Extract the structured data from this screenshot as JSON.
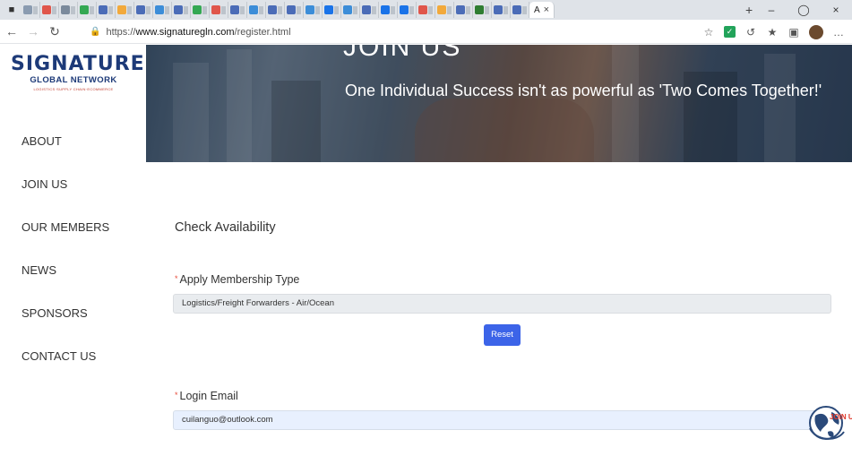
{
  "browser": {
    "active_tab_label": "A",
    "url_prefix": "https://",
    "url_host": "www.signaturegln.com",
    "url_path": "/register.html",
    "tab_favicons": [
      "#8a9bb0",
      "#e0564b",
      "#7b8a9c",
      "#34a853",
      "#4b6cb7",
      "#f2a93b",
      "#4b6cb7",
      "#3c8dd8",
      "#4b6cb7",
      "#34a853",
      "#e0564b",
      "#4b6cb7",
      "#3c8dd8",
      "#4b6cb7",
      "#4b6cb7",
      "#3c8dd8",
      "#1a73e8",
      "#3c8dd8",
      "#4b6cb7",
      "#1a73e8",
      "#1a73e8",
      "#e0564b",
      "#f2a93b",
      "#4b6cb7",
      "#2e7d32",
      "#4b6cb7",
      "#4b6cb7"
    ]
  },
  "logo": {
    "line1": "SIGNATURE",
    "line2": "GLOBAL NETWORK",
    "line3": "LOGISTICS·SUPPLY CHAIN·ECOMMERCE"
  },
  "menu": [
    "ABOUT",
    "JOIN US",
    "OUR MEMBERS",
    "NEWS",
    "SPONSORS",
    "CONTACT US"
  ],
  "hero": {
    "title": "JOIN US",
    "subtitle": "One Individual Success isn't as powerful as 'Two Comes Together!'"
  },
  "form": {
    "section_title": "Check Availability",
    "membership_label": "Apply Membership Type",
    "membership_value": "Logistics/Freight Forwarders - Air/Ocean",
    "reset_label": "Reset",
    "email_label": "Login Email",
    "email_value": "cuilanguo@outlook.com",
    "required_mark": "*"
  },
  "badge": {
    "text": "JOIN U"
  },
  "colors": {
    "brand_blue": "#1d3a78",
    "button": "#3c64e8",
    "required": "#e74c3c"
  }
}
